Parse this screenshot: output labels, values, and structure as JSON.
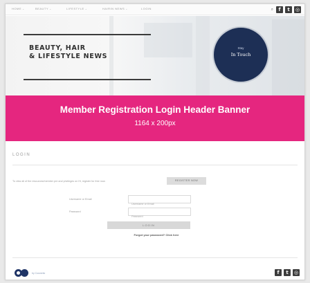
{
  "nav": {
    "items": [
      "HOME",
      "BEAUTY",
      "LIFESTYLE",
      "HAIRIN NEWS",
      "LOGIN"
    ]
  },
  "social": {
    "search_glyph": "⌕",
    "facebook": "f",
    "twitter": "t",
    "instagram": "◎"
  },
  "hero": {
    "title_line1": "BEAUTY, HAIR",
    "title_line2": "& LIFESTYLE NEWS",
    "circle_line1": "Stay",
    "circle_line2": "In Touch"
  },
  "banner": {
    "title": "Member Registration Login Header Banner",
    "size": "1164 x 200px",
    "color": "#e5267f"
  },
  "login": {
    "heading": "LOGIN",
    "intro": "To view all of the resources/member pre and privileges on Hi, register for free now.",
    "register_button": "REGISTER NOW",
    "username_label": "Username or Email",
    "username_placeholder": "Username or Email",
    "password_label": "Password",
    "password_placeholder": "Password",
    "login_button": "LOGIN",
    "forgot_link": "Forgot your password? Click here"
  },
  "footer": {
    "logo_text": "by Cosmetic"
  },
  "colors": {
    "accent": "#e5267f",
    "navy": "#1d2f55"
  }
}
